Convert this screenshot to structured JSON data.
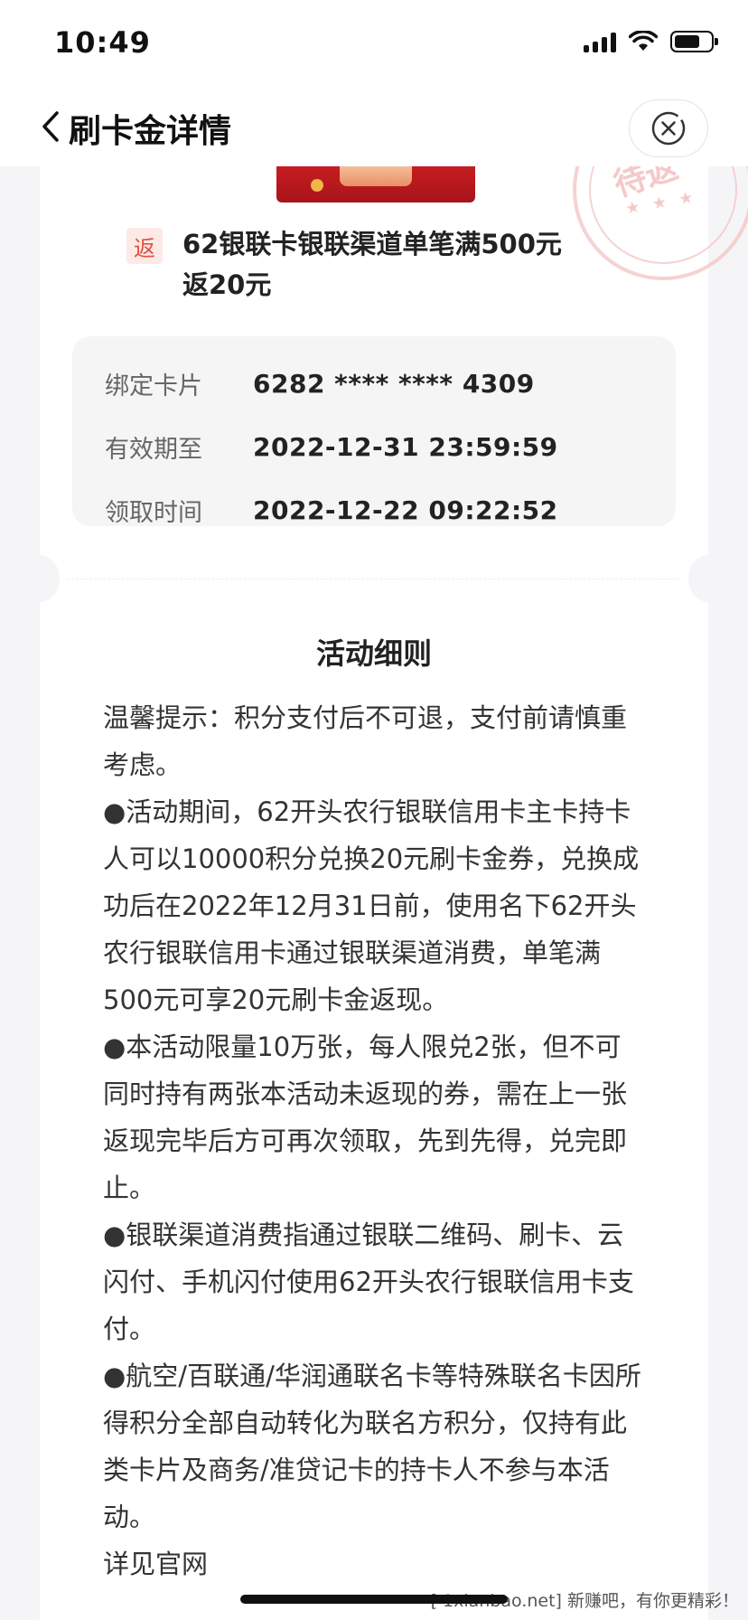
{
  "status_bar": {
    "time": "10:49"
  },
  "nav": {
    "title": "刷卡金详情"
  },
  "offer": {
    "badge": "返",
    "stamp_text": "待返",
    "stamp_stars": "★ ★ ★",
    "title": "62银联卡银联渠道单笔满500元返20元"
  },
  "info": [
    {
      "label": "绑定卡片",
      "value": "6282 **** **** 4309"
    },
    {
      "label": "有效期至",
      "value": "2022-12-31 23:59:59"
    },
    {
      "label": "领取时间",
      "value": "2022-12-22 09:22:52"
    }
  ],
  "rules": {
    "title": "活动细则",
    "paragraphs": [
      "温馨提示：积分支付后不可退，支付前请慎重考虑。",
      "●活动期间，62开头农行银联信用卡主卡持卡人可以10000积分兑换20元刷卡金券，兑换成功后在2022年12月31日前，使用名下62开头农行银联信用卡通过银联渠道消费，单笔满500元可享20元刷卡金返现。",
      "●本活动限量10万张，每人限兑2张，但不可同时持有两张本活动未返现的券，需在上一张返现完毕后方可再次领取，先到先得，兑完即止。",
      "●银联渠道消费指通过银联二维码、刷卡、云闪付、手机闪付使用62开头农行银联信用卡支付。",
      "●航空/百联通/华润通联名卡等特殊联名卡因所得积分全部自动转化为联名方积分，仅持有此类卡片及商务/准贷记卡的持卡人不参与本活动。",
      "详见官网"
    ]
  },
  "watermark": "[ 1xianbao.net] 新赚吧，有你更精彩！"
}
